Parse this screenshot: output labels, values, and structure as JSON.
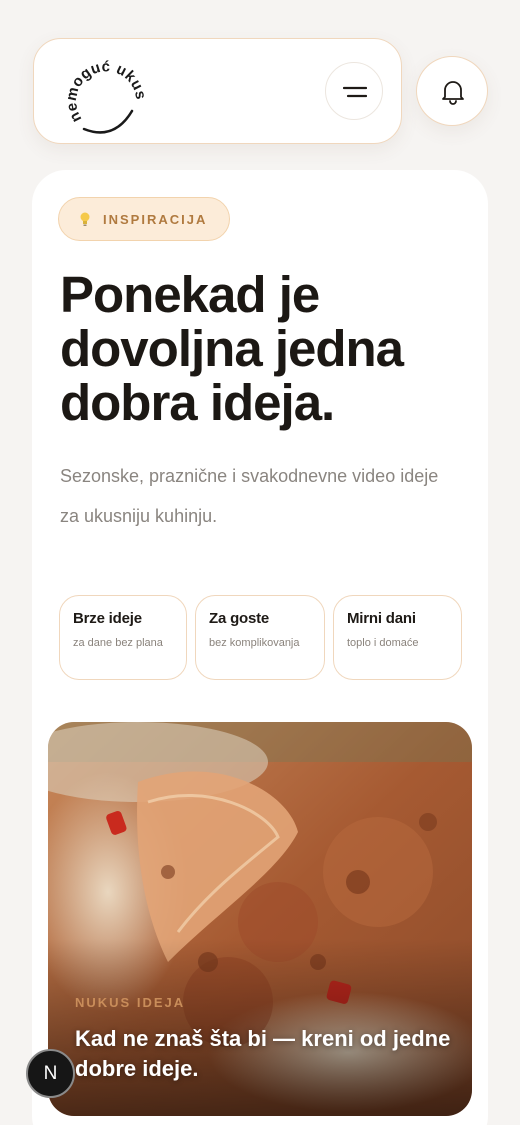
{
  "header": {
    "logo_text": "nemoguć ukus",
    "menu_icon": "menu-icon",
    "notification_icon": "bell-icon"
  },
  "badge": {
    "icon": "lightbulb-icon",
    "label": "INSPIRACIJA"
  },
  "hero_text": {
    "headline": "Ponekad je dovoljna jedna dobra ideja.",
    "subtitle": "Sezonske, praznične i svakodnevne video ideje za ukusniju kuhinju."
  },
  "chips": [
    {
      "title": "Brze ideje",
      "subtitle": "za dane bez plana"
    },
    {
      "title": "Za goste",
      "subtitle": "bez komplikovanja"
    },
    {
      "title": "Mirni dani",
      "subtitle": "toplo i domaće"
    }
  ],
  "feature": {
    "image": "food-photo",
    "tag": "NUKUS IDEJA",
    "title": "Kad ne znaš šta bi — kreni od jedne dobre ideje."
  },
  "floating_badge": {
    "label": "N"
  },
  "colors": {
    "accent": "#b07a3f",
    "accent_bg": "#fcecd9",
    "border": "#f0d7bd",
    "text": "#1c1814",
    "muted": "#8a8580"
  }
}
